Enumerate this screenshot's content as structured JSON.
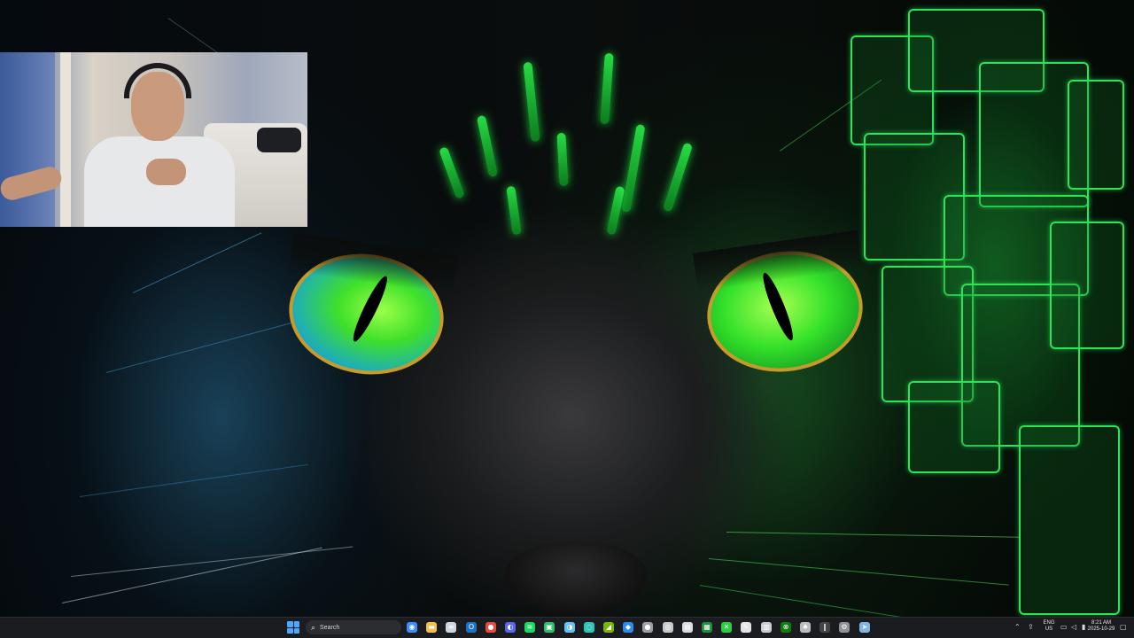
{
  "taskbar": {
    "search_placeholder": "Search",
    "search_icon": "search-icon",
    "pinned_apps": [
      {
        "name": "copilot-icon",
        "color": "#3b8cff",
        "glyph": "◉"
      },
      {
        "name": "file-explorer-icon",
        "color": "#f2c14e",
        "glyph": "▬"
      },
      {
        "name": "notepad-icon",
        "color": "#cfd6de",
        "glyph": "≡"
      },
      {
        "name": "outlook-icon",
        "color": "#1a73c9",
        "glyph": "O"
      },
      {
        "name": "chrome-icon",
        "color": "#e94b3c",
        "glyph": "●"
      },
      {
        "name": "discord-icon",
        "color": "#5865f2",
        "glyph": "◐"
      },
      {
        "name": "spotify-icon",
        "color": "#1ed760",
        "glyph": "≋"
      },
      {
        "name": "terminal-icon",
        "color": "#2fbf71",
        "glyph": "▣"
      },
      {
        "name": "steam-icon",
        "color": "#66c0f4",
        "glyph": "◑"
      },
      {
        "name": "edge-icon",
        "color": "#2ec4b6",
        "glyph": "◌"
      },
      {
        "name": "nvidia-icon",
        "color": "#76b900",
        "glyph": "◢"
      },
      {
        "name": "vscode-icon",
        "color": "#2a8cf0",
        "glyph": "◆"
      },
      {
        "name": "github-icon",
        "color": "#9aa0a6",
        "glyph": "●"
      },
      {
        "name": "obs-icon",
        "color": "#c8c8c8",
        "glyph": "◎"
      },
      {
        "name": "photos-icon",
        "color": "#d8dde3",
        "glyph": "▤"
      },
      {
        "name": "sheets-icon",
        "color": "#1e8e3e",
        "glyph": "▦"
      },
      {
        "name": "xbox-icon",
        "color": "#2ecc40",
        "glyph": "✕"
      },
      {
        "name": "snipping-icon",
        "color": "#e4e4e4",
        "glyph": "✎"
      },
      {
        "name": "calculator-icon",
        "color": "#c9ced6",
        "glyph": "▥"
      },
      {
        "name": "xbox-app-icon",
        "color": "#107c10",
        "glyph": "⊗"
      },
      {
        "name": "headset-icon",
        "color": "#bdbdbd",
        "glyph": "♠"
      },
      {
        "name": "mic-icon",
        "color": "#444444",
        "glyph": "❙"
      },
      {
        "name": "settings-icon",
        "color": "#8f9299",
        "glyph": "⚙"
      },
      {
        "name": "steam-app-icon",
        "color": "#7fb6e6",
        "glyph": "➤"
      }
    ],
    "tray": {
      "chevron_icon": "chevron-up-icon",
      "language_top": "ENG",
      "language_bottom": "US",
      "time": "8:21 AM",
      "date": "2025-10-29"
    }
  },
  "colors": {
    "accent_green": "#2ee25a",
    "taskbar_bg": "#1b1c20",
    "start_blue": "#4aa8ff"
  }
}
